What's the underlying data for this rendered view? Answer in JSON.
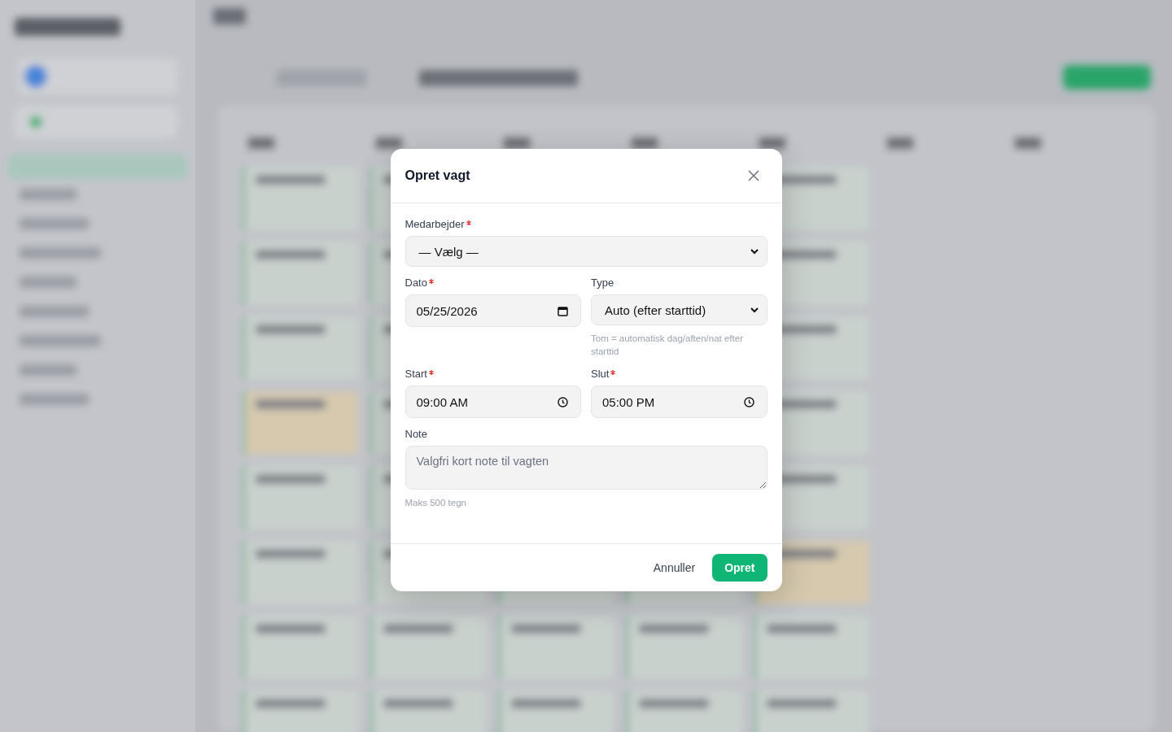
{
  "dialog": {
    "title": "Opret vagt",
    "rows": [
      [
        {
          "kind": "select",
          "label": "Medarbejder",
          "required": true,
          "value": "— Vælg —"
        }
      ],
      [
        {
          "kind": "date",
          "label": "Dato",
          "required": true,
          "value": "05/25/2026"
        },
        {
          "kind": "select",
          "label": "Type",
          "required": false,
          "value": "Auto (efter starttid)",
          "hint": "Tom = automatisk dag/aften/nat efter starttid"
        }
      ],
      [
        {
          "kind": "time",
          "label": "Start",
          "required": true,
          "value": "09:00 AM"
        },
        {
          "kind": "time",
          "label": "Slut",
          "required": true,
          "value": "05:00 PM"
        }
      ],
      [
        {
          "kind": "textarea",
          "label": "Note",
          "required": false,
          "placeholder": "Valgfri kort note til vagten",
          "hint": "Maks 500 tegn"
        }
      ]
    ],
    "buttons": [
      {
        "label": "Annuller",
        "kind": "secondary"
      },
      {
        "label": "Opret",
        "kind": "primary"
      }
    ]
  }
}
